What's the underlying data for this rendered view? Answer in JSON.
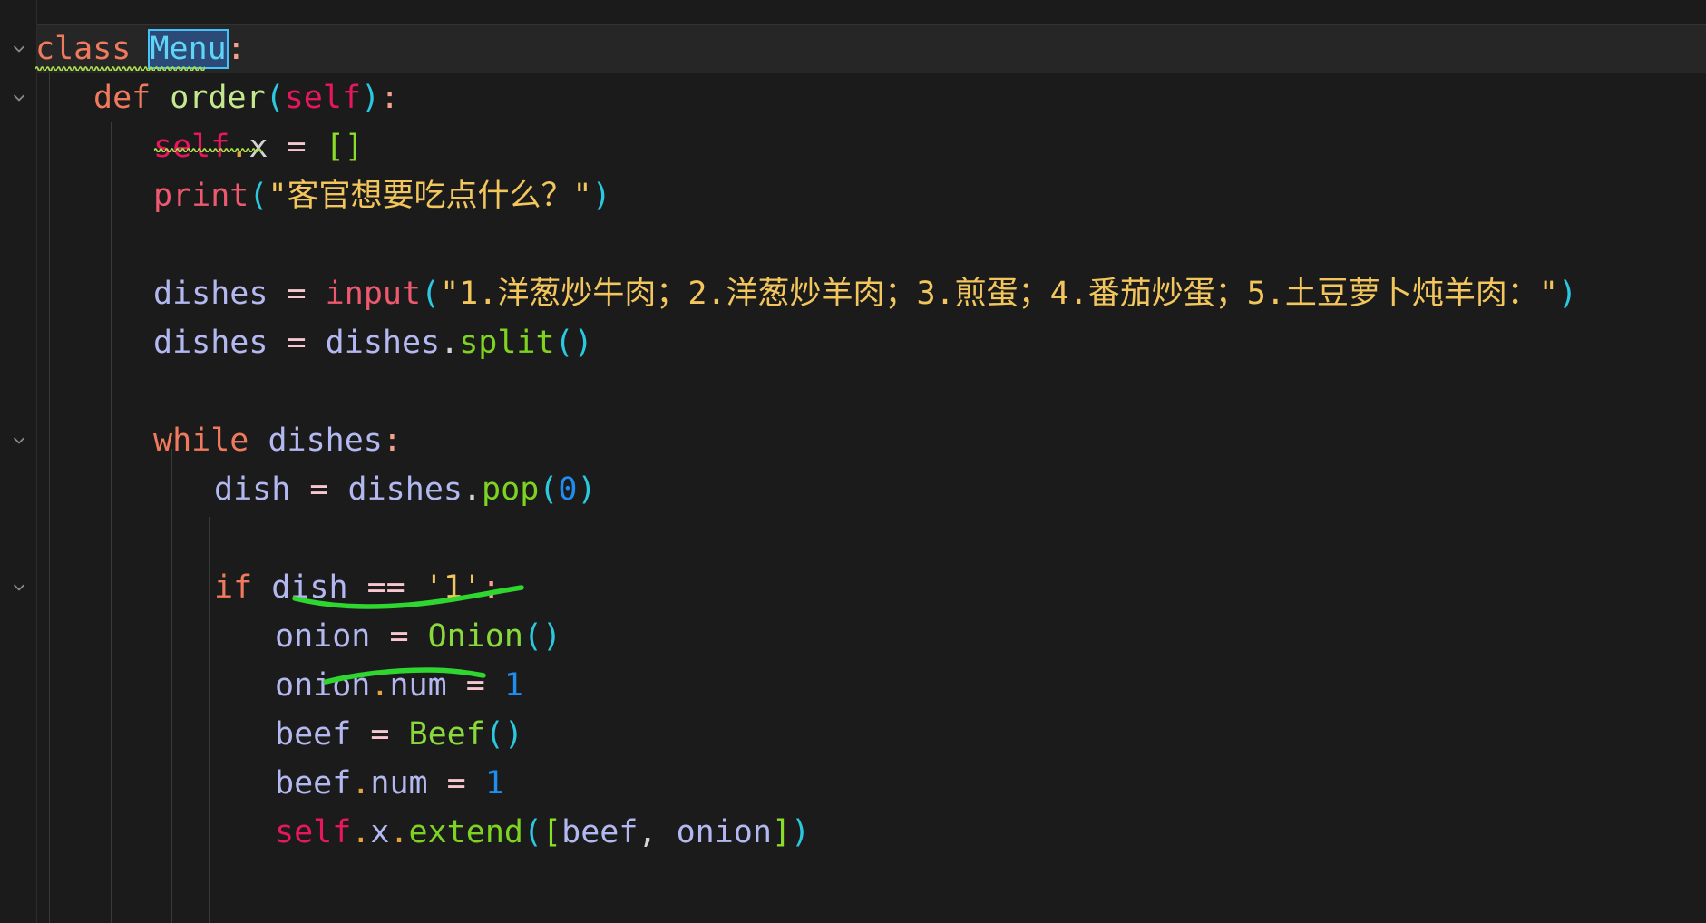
{
  "app": {
    "kind": "code-editor",
    "language": "python",
    "theme": "dark",
    "background_color": "#1b1b1b",
    "current_line_highlight": "#262626",
    "selection_fill": "#2b4a77",
    "selection_border": "#43c3f7",
    "annotation_color": "#2fd62f",
    "lint_squiggle_color": "#a8d94a"
  },
  "selection": {
    "text": "Menu",
    "description": "selected-word-highlight"
  },
  "icons": {
    "fold_chevron": "chevron-down-icon"
  },
  "code": {
    "lines": [
      {
        "n": 1,
        "fold": true,
        "indent": 0,
        "tokens": [
          {
            "text": "class",
            "cls": "t-kw"
          },
          {
            "text": " ",
            "cls": "t-white"
          },
          {
            "text": "Menu",
            "cls": "t-cls",
            "selected": true
          },
          {
            "text": ":",
            "cls": "t-colon"
          }
        ]
      },
      {
        "n": 2,
        "fold": true,
        "indent": 1,
        "tokens": [
          {
            "text": "def",
            "cls": "t-kw"
          },
          {
            "text": " ",
            "cls": "t-white"
          },
          {
            "text": "order",
            "cls": "t-fn"
          },
          {
            "text": "(",
            "cls": "t-paren"
          },
          {
            "text": "self",
            "cls": "t-self"
          },
          {
            "text": ")",
            "cls": "t-paren"
          },
          {
            "text": ":",
            "cls": "t-colon"
          }
        ]
      },
      {
        "n": 3,
        "fold": false,
        "indent": 2,
        "tokens": [
          {
            "text": "self",
            "cls": "t-self"
          },
          {
            "text": ".",
            "cls": "t-dot"
          },
          {
            "text": "x",
            "cls": "t-white"
          },
          {
            "text": " ",
            "cls": "t-white"
          },
          {
            "text": "=",
            "cls": "t-op"
          },
          {
            "text": " ",
            "cls": "t-white"
          },
          {
            "text": "[",
            "cls": "t-bracket"
          },
          {
            "text": "]",
            "cls": "t-bracket"
          }
        ]
      },
      {
        "n": 4,
        "fold": false,
        "indent": 2,
        "tokens": [
          {
            "text": "print",
            "cls": "t-kw2"
          },
          {
            "text": "(",
            "cls": "t-paren"
          },
          {
            "text": "\"客官想要吃点什么？\"",
            "cls": "t-str"
          },
          {
            "text": ")",
            "cls": "t-paren"
          }
        ]
      },
      {
        "n": 5,
        "fold": false,
        "indent": 2,
        "tokens": []
      },
      {
        "n": 6,
        "fold": false,
        "indent": 2,
        "tokens": [
          {
            "text": "dishes",
            "cls": "t-var"
          },
          {
            "text": " ",
            "cls": "t-white"
          },
          {
            "text": "=",
            "cls": "t-op"
          },
          {
            "text": " ",
            "cls": "t-white"
          },
          {
            "text": "input",
            "cls": "t-kw2"
          },
          {
            "text": "(",
            "cls": "t-paren"
          },
          {
            "text": "\"1.洋葱炒牛肉；2.洋葱炒羊肉；3.煎蛋；4.番茄炒蛋；5.土豆萝卜炖羊肉：\"",
            "cls": "t-str"
          },
          {
            "text": ")",
            "cls": "t-paren"
          }
        ]
      },
      {
        "n": 7,
        "fold": false,
        "indent": 2,
        "tokens": [
          {
            "text": "dishes",
            "cls": "t-var"
          },
          {
            "text": " ",
            "cls": "t-white"
          },
          {
            "text": "=",
            "cls": "t-op"
          },
          {
            "text": " ",
            "cls": "t-white"
          },
          {
            "text": "dishes",
            "cls": "t-var"
          },
          {
            "text": ".",
            "cls": "t-white"
          },
          {
            "text": "split",
            "cls": "t-method"
          },
          {
            "text": "(",
            "cls": "t-paren"
          },
          {
            "text": ")",
            "cls": "t-paren"
          }
        ]
      },
      {
        "n": 8,
        "fold": false,
        "indent": 2,
        "tokens": []
      },
      {
        "n": 9,
        "fold": true,
        "indent": 2,
        "tokens": [
          {
            "text": "while",
            "cls": "t-kw"
          },
          {
            "text": " ",
            "cls": "t-white"
          },
          {
            "text": "dishes",
            "cls": "t-var"
          },
          {
            "text": ":",
            "cls": "t-colon"
          }
        ]
      },
      {
        "n": 10,
        "fold": false,
        "indent": 3,
        "tokens": [
          {
            "text": "dish",
            "cls": "t-var"
          },
          {
            "text": " ",
            "cls": "t-white"
          },
          {
            "text": "=",
            "cls": "t-op"
          },
          {
            "text": " ",
            "cls": "t-white"
          },
          {
            "text": "dishes",
            "cls": "t-var"
          },
          {
            "text": ".",
            "cls": "t-white"
          },
          {
            "text": "pop",
            "cls": "t-method"
          },
          {
            "text": "(",
            "cls": "t-paren"
          },
          {
            "text": "0",
            "cls": "t-num"
          },
          {
            "text": ")",
            "cls": "t-paren"
          }
        ]
      },
      {
        "n": 11,
        "fold": false,
        "indent": 3,
        "tokens": []
      },
      {
        "n": 12,
        "fold": true,
        "indent": 3,
        "tokens": [
          {
            "text": "if",
            "cls": "t-kw"
          },
          {
            "text": " ",
            "cls": "t-white"
          },
          {
            "text": "dish",
            "cls": "t-var"
          },
          {
            "text": " ",
            "cls": "t-white"
          },
          {
            "text": "==",
            "cls": "t-op"
          },
          {
            "text": " ",
            "cls": "t-white"
          },
          {
            "text": "'1'",
            "cls": "t-str"
          },
          {
            "text": ":",
            "cls": "t-colon"
          }
        ]
      },
      {
        "n": 13,
        "fold": false,
        "indent": 4,
        "tokens": [
          {
            "text": "onion",
            "cls": "t-var"
          },
          {
            "text": " ",
            "cls": "t-white"
          },
          {
            "text": "=",
            "cls": "t-op"
          },
          {
            "text": " ",
            "cls": "t-white"
          },
          {
            "text": "Onion",
            "cls": "t-cls"
          },
          {
            "text": "(",
            "cls": "t-paren"
          },
          {
            "text": ")",
            "cls": "t-paren"
          }
        ]
      },
      {
        "n": 14,
        "fold": false,
        "indent": 4,
        "tokens": [
          {
            "text": "onion",
            "cls": "t-var"
          },
          {
            "text": ".",
            "cls": "t-dot"
          },
          {
            "text": "num",
            "cls": "t-var"
          },
          {
            "text": " ",
            "cls": "t-white"
          },
          {
            "text": "=",
            "cls": "t-op"
          },
          {
            "text": " ",
            "cls": "t-white"
          },
          {
            "text": "1",
            "cls": "t-num"
          }
        ]
      },
      {
        "n": 15,
        "fold": false,
        "indent": 4,
        "tokens": [
          {
            "text": "beef",
            "cls": "t-var"
          },
          {
            "text": " ",
            "cls": "t-white"
          },
          {
            "text": "=",
            "cls": "t-op"
          },
          {
            "text": " ",
            "cls": "t-white"
          },
          {
            "text": "Beef",
            "cls": "t-cls"
          },
          {
            "text": "(",
            "cls": "t-paren"
          },
          {
            "text": ")",
            "cls": "t-paren"
          }
        ]
      },
      {
        "n": 16,
        "fold": false,
        "indent": 4,
        "tokens": [
          {
            "text": "beef",
            "cls": "t-var"
          },
          {
            "text": ".",
            "cls": "t-dot"
          },
          {
            "text": "num",
            "cls": "t-var"
          },
          {
            "text": " ",
            "cls": "t-white"
          },
          {
            "text": "=",
            "cls": "t-op"
          },
          {
            "text": " ",
            "cls": "t-white"
          },
          {
            "text": "1",
            "cls": "t-num"
          }
        ]
      },
      {
        "n": 17,
        "fold": false,
        "indent": 4,
        "tokens": [
          {
            "text": "self",
            "cls": "t-self"
          },
          {
            "text": ".",
            "cls": "t-dot"
          },
          {
            "text": "x",
            "cls": "t-var"
          },
          {
            "text": ".",
            "cls": "t-dot"
          },
          {
            "text": "extend",
            "cls": "t-method"
          },
          {
            "text": "(",
            "cls": "t-paren"
          },
          {
            "text": "[",
            "cls": "t-bracket"
          },
          {
            "text": "beef",
            "cls": "t-var"
          },
          {
            "text": ",",
            "cls": "t-comma"
          },
          {
            "text": " ",
            "cls": "t-white"
          },
          {
            "text": "onion",
            "cls": "t-var"
          },
          {
            "text": "]",
            "cls": "t-bracket"
          },
          {
            "text": ")",
            "cls": "t-paren"
          }
        ]
      }
    ]
  },
  "lint_squiggles": [
    {
      "line": 1,
      "label": "spell-warning-class-menu"
    },
    {
      "line": 3,
      "label": "spell-warning-self-x"
    }
  ],
  "annotations": [
    {
      "target": "onion.num = 1",
      "label": "green-underline-stroke-1"
    },
    {
      "target": "beef.num = 1",
      "label": "green-underline-stroke-2"
    }
  ]
}
